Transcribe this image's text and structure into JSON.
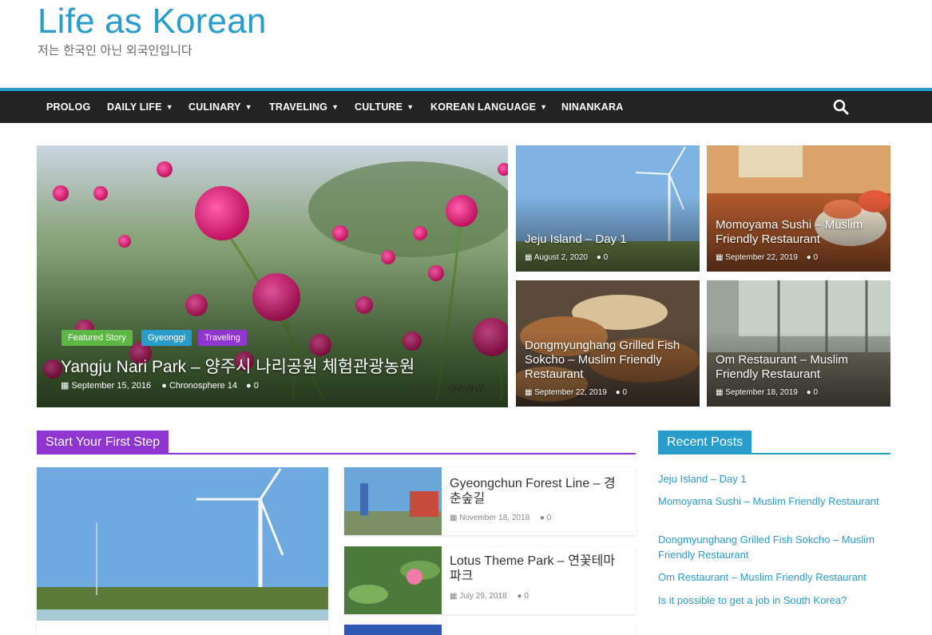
{
  "site": {
    "title": "Life as Korean",
    "description": "저는 한국인 아닌 외국인입니다"
  },
  "colors": {
    "accent": "#289dcc",
    "nav_bg": "#232323",
    "featured": "#5cb844",
    "purple": "#8e36cf"
  },
  "nav": {
    "items": [
      {
        "label": "PROLOG"
      },
      {
        "label": "DAILY LIFE"
      },
      {
        "label": "CULINARY"
      },
      {
        "label": "TRAVELING"
      },
      {
        "label": "CULTURE"
      },
      {
        "label": "KOREAN LANGUAGE"
      },
      {
        "label": "NINANKARA"
      }
    ],
    "search_icon": "search-icon"
  },
  "hero": {
    "badges": [
      "Featured Story",
      "Gyeonggi",
      "Traveling"
    ],
    "title": "Yangju Nari Park – 양주시 나리공원 체험관광농원",
    "date": "September 15, 2016",
    "author": "Chronosphere 14",
    "comments": "0",
    "watermark": "아리아리"
  },
  "tiles": [
    {
      "title": "Jeju Island – Day 1",
      "date": "August 2, 2020",
      "comments": "0"
    },
    {
      "title": "Momoyama Sushi – Muslim Friendly Restaurant",
      "date": "September 22, 2019",
      "comments": "0"
    },
    {
      "title": "Dongmyunghang Grilled Fish Sokcho – Muslim Friendly Restaurant",
      "date": "September 22, 2019",
      "comments": "0"
    },
    {
      "title": "Om Restaurant – Muslim Friendly Restaurant",
      "date": "September 18, 2019",
      "comments": "0"
    }
  ],
  "first_step": {
    "heading": "Start Your First Step",
    "posts": [
      {
        "title": "Gyeongchun Forest Line – 경춘숲길",
        "date": "November 18, 2018",
        "comments": "0"
      },
      {
        "title": "Lotus Theme Park – 연꽃테마파크",
        "date": "July 29, 2018",
        "comments": "0"
      }
    ]
  },
  "recent": {
    "heading": "Recent Posts",
    "items": [
      "Jeju Island – Day 1",
      "Momoyama Sushi – Muslim Friendly Restaurant",
      "Dongmyunghang Grilled Fish Sokcho – Muslim Friendly Restaurant",
      "Om Restaurant – Muslim Friendly Restaurant",
      "Is it possible to get a job in South Korea?"
    ]
  }
}
